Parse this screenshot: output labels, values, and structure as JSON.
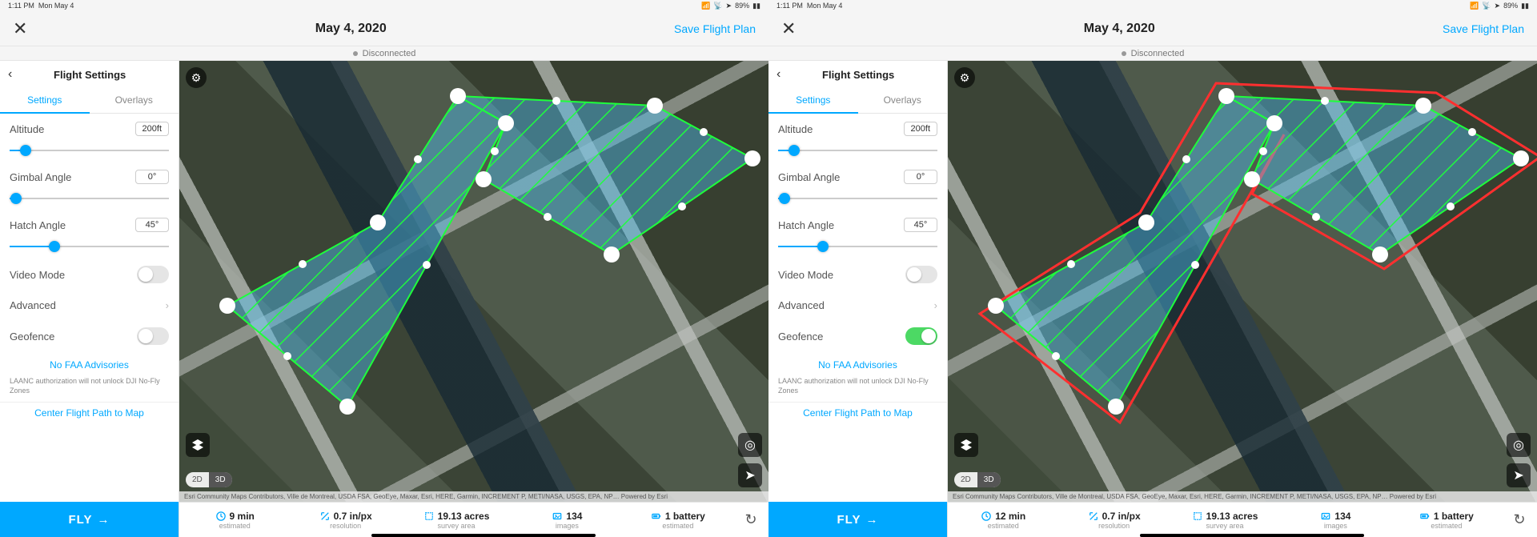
{
  "panes": [
    {
      "status": {
        "time": "1:11 PM",
        "date": "Mon May 4",
        "battery": "89%"
      },
      "header": {
        "title": "May 4, 2020",
        "save": "Save Flight Plan"
      },
      "disconnected": "Disconnected",
      "sidebar": {
        "title": "Flight Settings",
        "tabs": {
          "settings": "Settings",
          "overlays": "Overlays"
        },
        "altitude": {
          "label": "Altitude",
          "value": "200ft",
          "pos": 10
        },
        "gimbal": {
          "label": "Gimbal Angle",
          "value": "0°",
          "pos": 4
        },
        "hatch": {
          "label": "Hatch Angle",
          "value": "45°",
          "pos": 28
        },
        "video": {
          "label": "Video Mode",
          "on": false
        },
        "advanced": {
          "label": "Advanced"
        },
        "geofence": {
          "label": "Geofence",
          "on": false
        },
        "advisory": "No FAA Advisories",
        "disclaimer": "LAANC authorization will not unlock DJI No-Fly Zones",
        "center": "Center Flight Path to Map",
        "fly": "FLY"
      },
      "footer": {
        "time": {
          "v": "9 min",
          "l": "estimated"
        },
        "res": {
          "v": "0.7 in/px",
          "l": "resolution"
        },
        "area": {
          "v": "19.13 acres",
          "l": "survey area"
        },
        "img": {
          "v": "134",
          "l": "images"
        },
        "bat": {
          "v": "1 battery",
          "l": "estimated"
        }
      },
      "d2d3": {
        "d2": "2D",
        "d3": "3D"
      },
      "attrib": "Esri Community Maps Contributors, Ville de Montreal, USDA FSA, GeoEye, Maxar, Esri, HERE, Garmin, INCREMENT P, METI/NASA, USGS, EPA, NP…    Powered by Esri",
      "geofence_outline": false
    },
    {
      "status": {
        "time": "1:11 PM",
        "date": "Mon May 4",
        "battery": "89%"
      },
      "header": {
        "title": "May 4, 2020",
        "save": "Save Flight Plan"
      },
      "disconnected": "Disconnected",
      "sidebar": {
        "title": "Flight Settings",
        "tabs": {
          "settings": "Settings",
          "overlays": "Overlays"
        },
        "altitude": {
          "label": "Altitude",
          "value": "200ft",
          "pos": 10
        },
        "gimbal": {
          "label": "Gimbal Angle",
          "value": "0°",
          "pos": 4
        },
        "hatch": {
          "label": "Hatch Angle",
          "value": "45°",
          "pos": 28
        },
        "video": {
          "label": "Video Mode",
          "on": false
        },
        "advanced": {
          "label": "Advanced"
        },
        "geofence": {
          "label": "Geofence",
          "on": true
        },
        "advisory": "No FAA Advisories",
        "disclaimer": "LAANC authorization will not unlock DJI No-Fly Zones",
        "center": "Center Flight Path to Map",
        "fly": "FLY"
      },
      "footer": {
        "time": {
          "v": "12 min",
          "l": "estimated"
        },
        "res": {
          "v": "0.7 in/px",
          "l": "resolution"
        },
        "area": {
          "v": "19.13 acres",
          "l": "survey area"
        },
        "img": {
          "v": "134",
          "l": "images"
        },
        "bat": {
          "v": "1 battery",
          "l": "estimated"
        }
      },
      "d2d3": {
        "d2": "2D",
        "d3": "3D"
      },
      "attrib": "Esri Community Maps Contributors, Ville de Montreal, USDA FSA, GeoEye, Maxar, Esri, HERE, Garmin, INCREMENT P, METI/NASA, USGS, EPA, NP…    Powered by Esri",
      "geofence_outline": true
    }
  ]
}
